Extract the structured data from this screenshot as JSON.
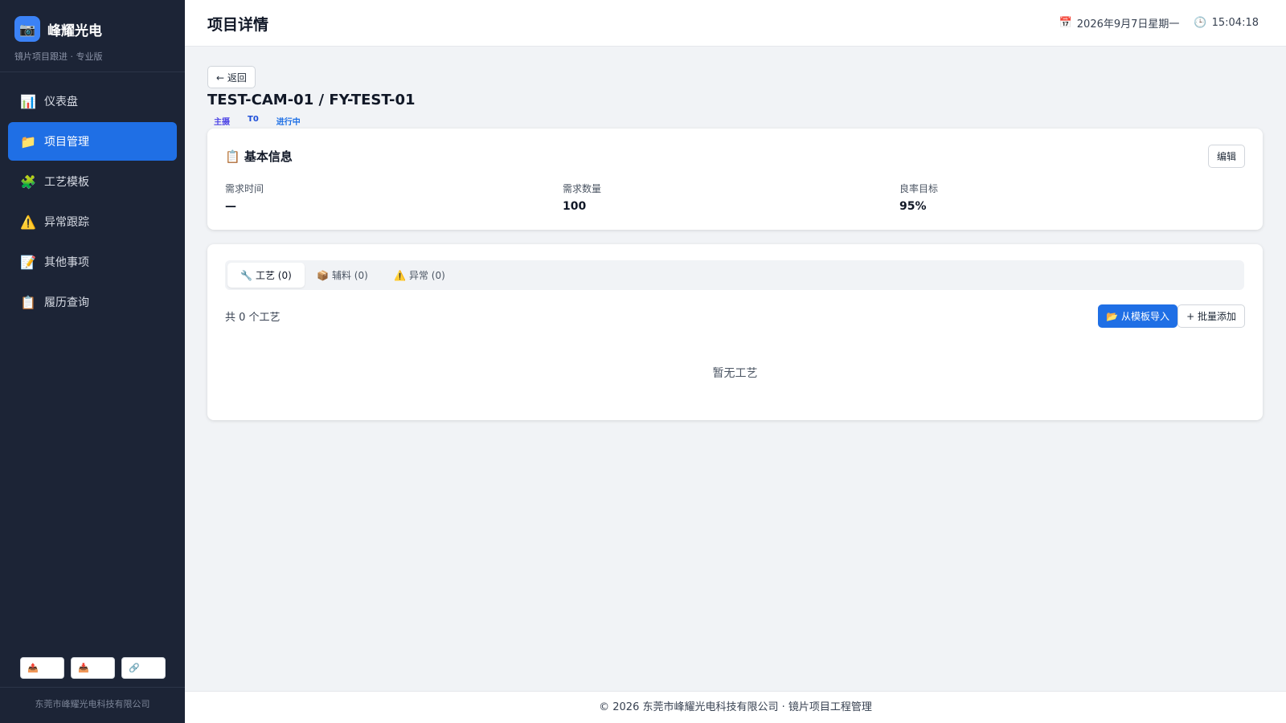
{
  "brand": {
    "logo_icon": "camera-icon",
    "name": "峰耀光电",
    "subtitle": "镜片项目跟进 · 专业版"
  },
  "sidebar": {
    "items": [
      {
        "icon": "📊",
        "icon_name": "chart-icon",
        "label": "仪表盘",
        "active": false
      },
      {
        "icon": "📁",
        "icon_name": "folder-icon",
        "label": "项目管理",
        "active": true
      },
      {
        "icon": "🧩",
        "icon_name": "puzzle-icon",
        "label": "工艺模板",
        "active": false
      },
      {
        "icon": "⚠️",
        "icon_name": "warning-icon",
        "label": "异常跟踪",
        "active": false
      },
      {
        "icon": "📝",
        "icon_name": "memo-icon",
        "label": "其他事项",
        "active": false
      },
      {
        "icon": "📋",
        "icon_name": "clipboard-icon",
        "label": "履历查询",
        "active": false
      }
    ],
    "tools": [
      {
        "icon": "📤",
        "icon_name": "export-icon"
      },
      {
        "icon": "📥",
        "icon_name": "import-icon"
      },
      {
        "icon": "🔗",
        "icon_name": "link-icon"
      }
    ],
    "footer": "东莞市峰耀光电科技有限公司"
  },
  "header": {
    "title": "项目详情",
    "date_icon": "📅",
    "date": "2026年9月7日星期一",
    "time_icon": "🕒",
    "time": "15:04:18"
  },
  "project": {
    "back_label": "← 返回",
    "title": "TEST-CAM-01 / FY-TEST-01",
    "tags": [
      "主摄",
      "T0",
      "进行中"
    ]
  },
  "basic_info": {
    "title": "📋 基本信息",
    "edit_label": "编辑",
    "fields": [
      {
        "label": "需求时间",
        "value": "—"
      },
      {
        "label": "需求数量",
        "value": "100"
      },
      {
        "label": "良率目标",
        "value": "95%"
      }
    ]
  },
  "tabs": [
    {
      "icon": "🔧",
      "icon_name": "wrench-icon",
      "label": "工艺 (0)",
      "active": true
    },
    {
      "icon": "📦",
      "icon_name": "package-icon",
      "label": "辅料 (0)",
      "active": false
    },
    {
      "icon": "⚠️",
      "icon_name": "warning-icon",
      "label": "异常 (0)",
      "active": false
    }
  ],
  "process": {
    "count_text": "共 0 个工艺",
    "import_label": "📂 从模板导入",
    "batch_label": "+ 批量添加",
    "empty_text": "暂无工艺"
  },
  "footer": {
    "text": "© 2026 东莞市峰耀光电科技有限公司 · 镜片项目工程管理"
  },
  "colors": {
    "sidebar_bg": "#1c2436",
    "accent": "#1f6fe5",
    "page_bg": "#f1f3f6"
  }
}
